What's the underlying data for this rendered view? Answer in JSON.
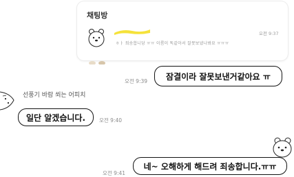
{
  "quote": {
    "title": "채팅방",
    "text": "ㅎㅏ 죄송합니당 ㅠㅠ 이름이 똑같아서 잘못보냈나봐요 ㅠㅠㅠ",
    "time": "오전 9:37"
  },
  "messages": [
    {
      "side": "right",
      "text": "잠결이라 잘못보낸거같아요 ㅠ",
      "time": "오전 9:39"
    },
    {
      "side": "left",
      "sender": "선풍기 바람 쐬는 어피치",
      "text": "일단 알겠습니다.",
      "time": "오전 9:40"
    },
    {
      "side": "right",
      "text": "네~ 오해하게 해드려 죄송합니다.ㅠㅠ",
      "time": "오전 9:41"
    }
  ],
  "colors": {
    "background": "#ffffff",
    "bubble_border": "#111111",
    "highlight": "#f5e23a"
  },
  "icons": {
    "quote_avatar": "bear-character-icon",
    "right_avatar": "bear-character-icon",
    "left_avatar": "character-avatar-icon"
  }
}
